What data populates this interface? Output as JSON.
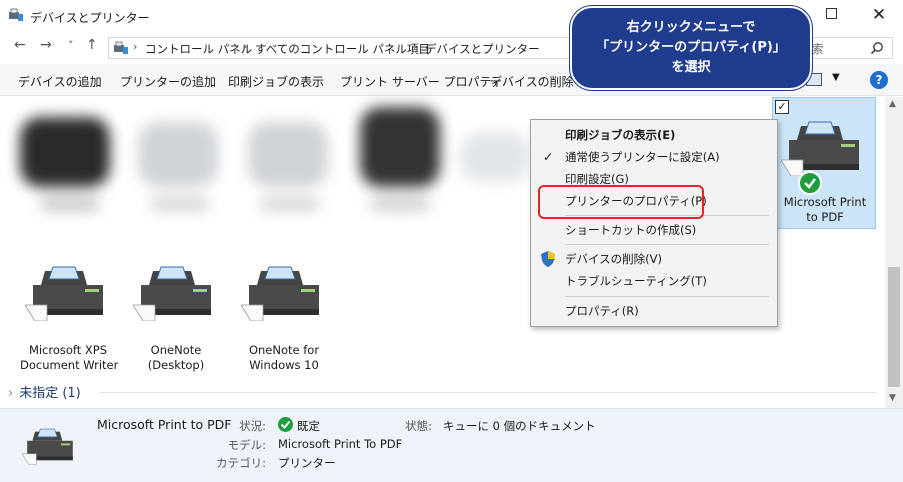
{
  "window": {
    "title": "デバイスとプリンター"
  },
  "nav": {
    "back": "←",
    "forward": "→",
    "recent": "˅",
    "up": "↑",
    "breadcrumb": [
      "コントロール パネル",
      "すべてのコントロール パネル項目",
      "デバイスとプリンター"
    ],
    "search_placeholder": "索"
  },
  "commands": [
    "デバイスの追加",
    "プリンターの追加",
    "印刷ジョブの表示",
    "プリント サーバー プロパティ",
    "デバイスの削除"
  ],
  "devices": [
    {
      "label_line1": "Microsoft XPS",
      "label_line2": "Document Writer"
    },
    {
      "label_line1": "OneNote",
      "label_line2": "(Desktop)"
    },
    {
      "label_line1": "OneNote for",
      "label_line2": "Windows 10"
    }
  ],
  "selected_device": {
    "label_line1": "Microsoft Print",
    "label_line2": "to PDF"
  },
  "group": {
    "title": "未指定 (1)"
  },
  "context_menu": {
    "items": [
      "印刷ジョブの表示(E)",
      "通常使うプリンターに設定(A)",
      "印刷設定(G)",
      "プリンターのプロパティ(P)",
      "ショートカットの作成(S)",
      "デバイスの削除(V)",
      "トラブルシューティング(T)",
      "プロパティ(R)"
    ]
  },
  "callout": {
    "line1": "右クリックメニューで",
    "line2": "「プリンターのプロパティ(P)」",
    "line3": "を選択"
  },
  "details": {
    "name": "Microsoft Print to PDF",
    "status_key": "状況:",
    "status_val": "既定",
    "model_key": "モデル:",
    "model_val": "Microsoft Print To PDF",
    "category_key": "カテゴリ:",
    "category_val": "プリンター",
    "state_key": "状態:",
    "state_val": "キューに 0 個のドキュメント"
  },
  "colors": {
    "accent": "#1f3c8f",
    "highlight": "#e3262e",
    "selection": "#cce4f7",
    "ok": "#1e9e3a"
  }
}
